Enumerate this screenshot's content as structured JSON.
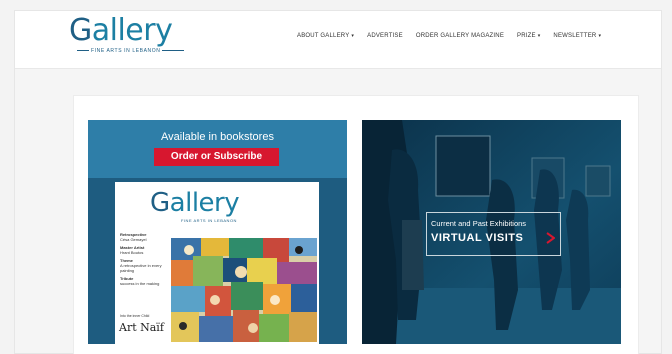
{
  "header": {
    "logo_word": "allery",
    "logo_initial": "G",
    "logo_tagline": "FINE ARTS IN LEBANON"
  },
  "nav": {
    "items": [
      {
        "label": "ABOUT GALLERY",
        "caret": "▾"
      },
      {
        "label": "ADVERTISE"
      },
      {
        "label": "ORDER GALLERY MAGAZINE"
      },
      {
        "label": "PRIZE",
        "caret": "▾"
      },
      {
        "label": "NEWSLETTER",
        "caret": "▾"
      }
    ]
  },
  "promo": {
    "available_text": "Available in bookstores",
    "order_button": "Order or Subscribe",
    "cover": {
      "logo_initial": "G",
      "logo_word": "allery",
      "tagline": "FINE ARTS IN LEBANON",
      "blurbs": [
        {
          "head": "Retrospective",
          "sub": "Césa Gemayel"
        },
        {
          "head": "Master Artist",
          "sub": "Hrant Boutos"
        },
        {
          "head": "Theme",
          "sub": "A retrospective in every painting"
        },
        {
          "head": "Tribute",
          "sub": "success in the making"
        }
      ],
      "art_small": "Into the inner Child",
      "art_title": "Art Naïf"
    }
  },
  "virtual": {
    "small_text": "Current and Past Exhibitions",
    "big_text": "VIRTUAL VISITS"
  },
  "colors": {
    "brand": "#1c7fa3",
    "order_red": "#d7172f",
    "promo_bg": "#1e5c80"
  }
}
